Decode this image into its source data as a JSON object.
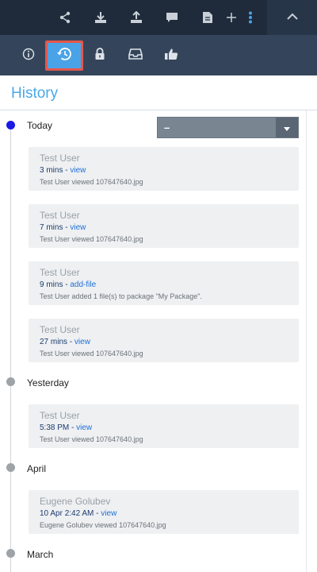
{
  "toolbar": {
    "icons": [
      "share-icon",
      "download-icon",
      "upload-icon",
      "comment-icon",
      "document-icon",
      "plus-icon",
      "more-vertical-icon"
    ],
    "collapse_icon": "chevron-up-icon"
  },
  "tabs": [
    {
      "name": "info-icon",
      "active": false
    },
    {
      "name": "history-icon",
      "active": true
    },
    {
      "name": "lock-icon",
      "active": false
    },
    {
      "name": "inbox-icon",
      "active": false
    },
    {
      "name": "thumbs-up-icon",
      "active": false
    }
  ],
  "header": {
    "title": "History"
  },
  "filter": {
    "value": "–"
  },
  "groups": [
    {
      "label": "Today"
    },
    {
      "label": "Yesterday"
    },
    {
      "label": "April"
    },
    {
      "label": "March"
    }
  ],
  "entries": [
    {
      "user": "Test User",
      "time": "3 mins",
      "action": "view",
      "desc": "Test User viewed 107647640.jpg"
    },
    {
      "user": "Test User",
      "time": "7 mins",
      "action": "view",
      "desc": "Test User viewed 107647640.jpg"
    },
    {
      "user": "Test User",
      "time": "9 mins",
      "action": "add-file",
      "desc": "Test User added 1 file(s) to package \"My Package\"."
    },
    {
      "user": "Test User",
      "time": "27 mins",
      "action": "view",
      "desc": "Test User viewed 107647640.jpg"
    },
    {
      "user": "Test User",
      "time": "5:38 PM",
      "action": "view",
      "desc": "Test User viewed 107647640.jpg"
    },
    {
      "user": "Eugene Golubev",
      "time": "10 Apr 2:42 AM",
      "action": "view",
      "desc": "Eugene Golubev viewed 107647640.jpg"
    }
  ],
  "sep": " - ",
  "colors": {
    "accent": "#4aa8e8",
    "active_tab": "#4aa3e6",
    "highlight": "#e5574c",
    "current_dot": "#1a1ae6"
  }
}
